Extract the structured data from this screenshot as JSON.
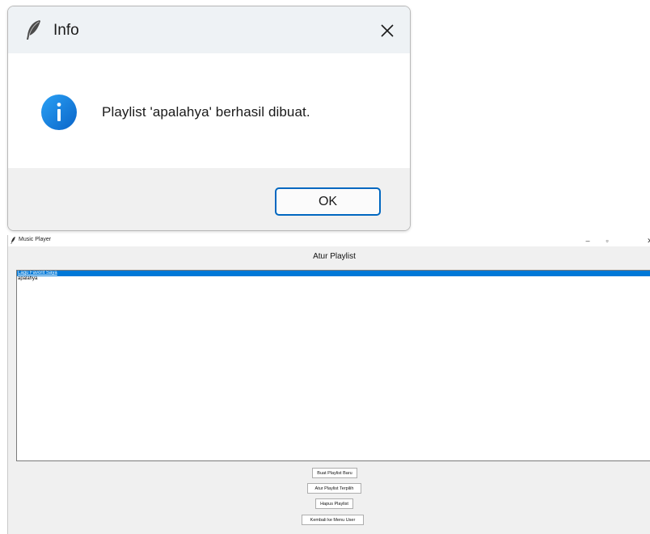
{
  "dialog": {
    "title": "Info",
    "message": "Playlist 'apalahya' berhasil dibuat.",
    "ok_label": "OK",
    "close_glyph": "✕",
    "title_icon": "feather-icon",
    "message_icon": "info-icon",
    "accent_color": "#0067c0"
  },
  "window": {
    "title": "Music Player",
    "minimize_glyph": "–",
    "maximize_glyph": "▫",
    "close_glyph": "✕",
    "heading": "Atur Playlist",
    "playlists": [
      {
        "label": "Lagu Favorit Saya",
        "selected": true
      },
      {
        "label": "apalahya",
        "selected": false
      }
    ],
    "buttons": {
      "create": "Buat Playlist Baru",
      "manage": "Atur Playlist Terpilih",
      "delete": "Hapus Playlist",
      "back": "Kembali ke Menu User"
    },
    "selection_color": "#0078d7"
  }
}
